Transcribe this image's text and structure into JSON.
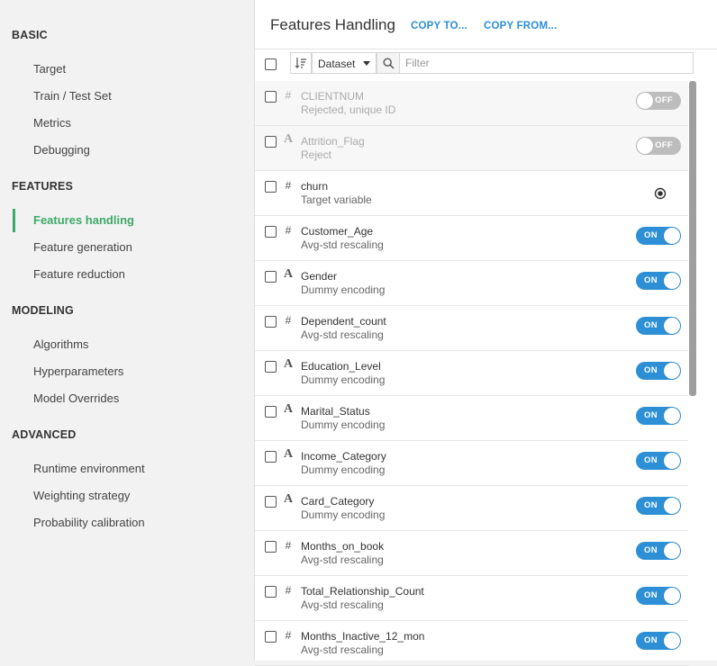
{
  "sidebar": {
    "sections": [
      {
        "title": "BASIC",
        "items": [
          "Target",
          "Train / Test Set",
          "Metrics",
          "Debugging"
        ]
      },
      {
        "title": "FEATURES",
        "items": [
          "Features handling",
          "Feature generation",
          "Feature reduction"
        ]
      },
      {
        "title": "MODELING",
        "items": [
          "Algorithms",
          "Hyperparameters",
          "Model Overrides"
        ]
      },
      {
        "title": "ADVANCED",
        "items": [
          "Runtime environment",
          "Weighting strategy",
          "Probability calibration"
        ]
      }
    ],
    "active_item": "Features handling"
  },
  "panel": {
    "title": "Features Handling",
    "copy_to": "COPY TO...",
    "copy_from": "COPY FROM..."
  },
  "toolbar": {
    "dataset_label": "Dataset",
    "filter_placeholder": "Filter"
  },
  "features": [
    {
      "icon": "numeric-icon",
      "name": "CLIENTNUM",
      "desc": "Rejected, unique ID",
      "state": "off",
      "toggle_label": "OFF"
    },
    {
      "icon": "text-icon",
      "name": "Attrition_Flag",
      "desc": "Reject",
      "state": "off",
      "toggle_label": "OFF"
    },
    {
      "icon": "numeric-icon",
      "name": "churn",
      "desc": "Target variable",
      "state": "target"
    },
    {
      "icon": "numeric-icon",
      "name": "Customer_Age",
      "desc": "Avg-std rescaling",
      "state": "on",
      "toggle_label": "ON"
    },
    {
      "icon": "text-icon",
      "name": "Gender",
      "desc": "Dummy encoding",
      "state": "on",
      "toggle_label": "ON"
    },
    {
      "icon": "numeric-icon",
      "name": "Dependent_count",
      "desc": "Avg-std rescaling",
      "state": "on",
      "toggle_label": "ON"
    },
    {
      "icon": "text-icon",
      "name": "Education_Level",
      "desc": "Dummy encoding",
      "state": "on",
      "toggle_label": "ON"
    },
    {
      "icon": "text-icon",
      "name": "Marital_Status",
      "desc": "Dummy encoding",
      "state": "on",
      "toggle_label": "ON"
    },
    {
      "icon": "text-icon",
      "name": "Income_Category",
      "desc": "Dummy encoding",
      "state": "on",
      "toggle_label": "ON"
    },
    {
      "icon": "text-icon",
      "name": "Card_Category",
      "desc": "Dummy encoding",
      "state": "on",
      "toggle_label": "ON"
    },
    {
      "icon": "numeric-icon",
      "name": "Months_on_book",
      "desc": "Avg-std rescaling",
      "state": "on",
      "toggle_label": "ON"
    },
    {
      "icon": "numeric-icon",
      "name": "Total_Relationship_Count",
      "desc": "Avg-std rescaling",
      "state": "on",
      "toggle_label": "ON"
    },
    {
      "icon": "numeric-icon",
      "name": "Months_Inactive_12_mon",
      "desc": "Avg-std rescaling",
      "state": "on",
      "toggle_label": "ON"
    }
  ],
  "icon_glyphs": {
    "numeric-icon": "#",
    "text-icon": "A"
  },
  "colors": {
    "accent": "#2d8fd5",
    "active_nav": "#3ea968",
    "toggle_off": "#bdbdbd"
  }
}
